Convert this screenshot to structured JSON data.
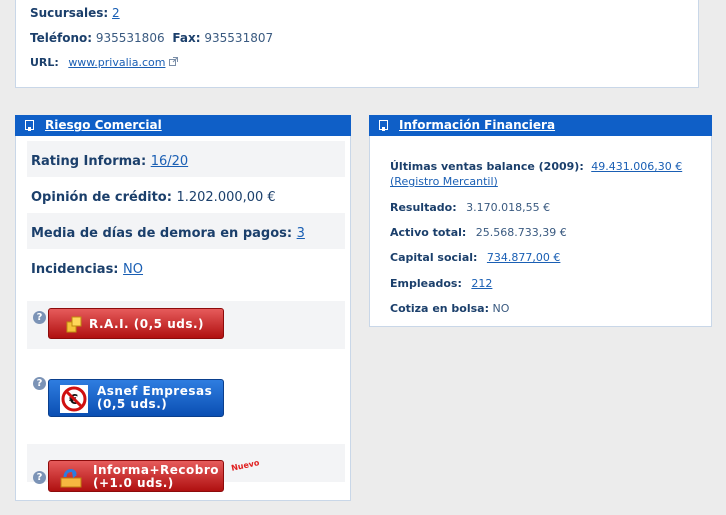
{
  "contact": {
    "sucursales_label": "Sucursales:",
    "sucursales_value": "2",
    "telefono_label": "Teléfono:",
    "telefono_value": "935531806",
    "fax_label": "Fax:",
    "fax_value": "935531807",
    "url_label": "URL:",
    "url_value": "www.privalia.com"
  },
  "riesgo": {
    "title": "Riesgo Comercial",
    "rating_label": "Rating Informa:",
    "rating_value": "16/20",
    "opinion_label": "Opinión de crédito:",
    "opinion_value": "1.202.000,00 €",
    "media_label": "Media de días de demora en pagos:",
    "media_value": "3",
    "incidencias_label": "Incidencias:",
    "incidencias_value": "NO",
    "rai_button": "R.A.I. (0,5 uds.)",
    "asnef_line1": "Asnef Empresas",
    "asnef_line2": "(0,5 uds.)",
    "recobro_line1": "Informa+Recobro",
    "recobro_line2": "(+1.0 uds.)",
    "nuevo": "Nuevo"
  },
  "financiera": {
    "title": "Información Financiera",
    "ventas_label": "Últimas ventas balance (2009):",
    "ventas_value": "49.431.006,30 €",
    "ventas_source": "(Registro Mercantil)",
    "resultado_label": "Resultado:",
    "resultado_value": "3.170.018,55 €",
    "activo_label": "Activo total:",
    "activo_value": "25.568.733,39 €",
    "capital_label": "Capital social:",
    "capital_value": "734.877,00 €",
    "empleados_label": "Empleados:",
    "empleados_value": "212",
    "bolsa_label": "Cotiza en bolsa:",
    "bolsa_value": "NO"
  },
  "colors": {
    "header_blue": "#0f5fc7",
    "link": "#1a5fb4",
    "button_red": "#c22020",
    "button_blue": "#1461c8"
  }
}
